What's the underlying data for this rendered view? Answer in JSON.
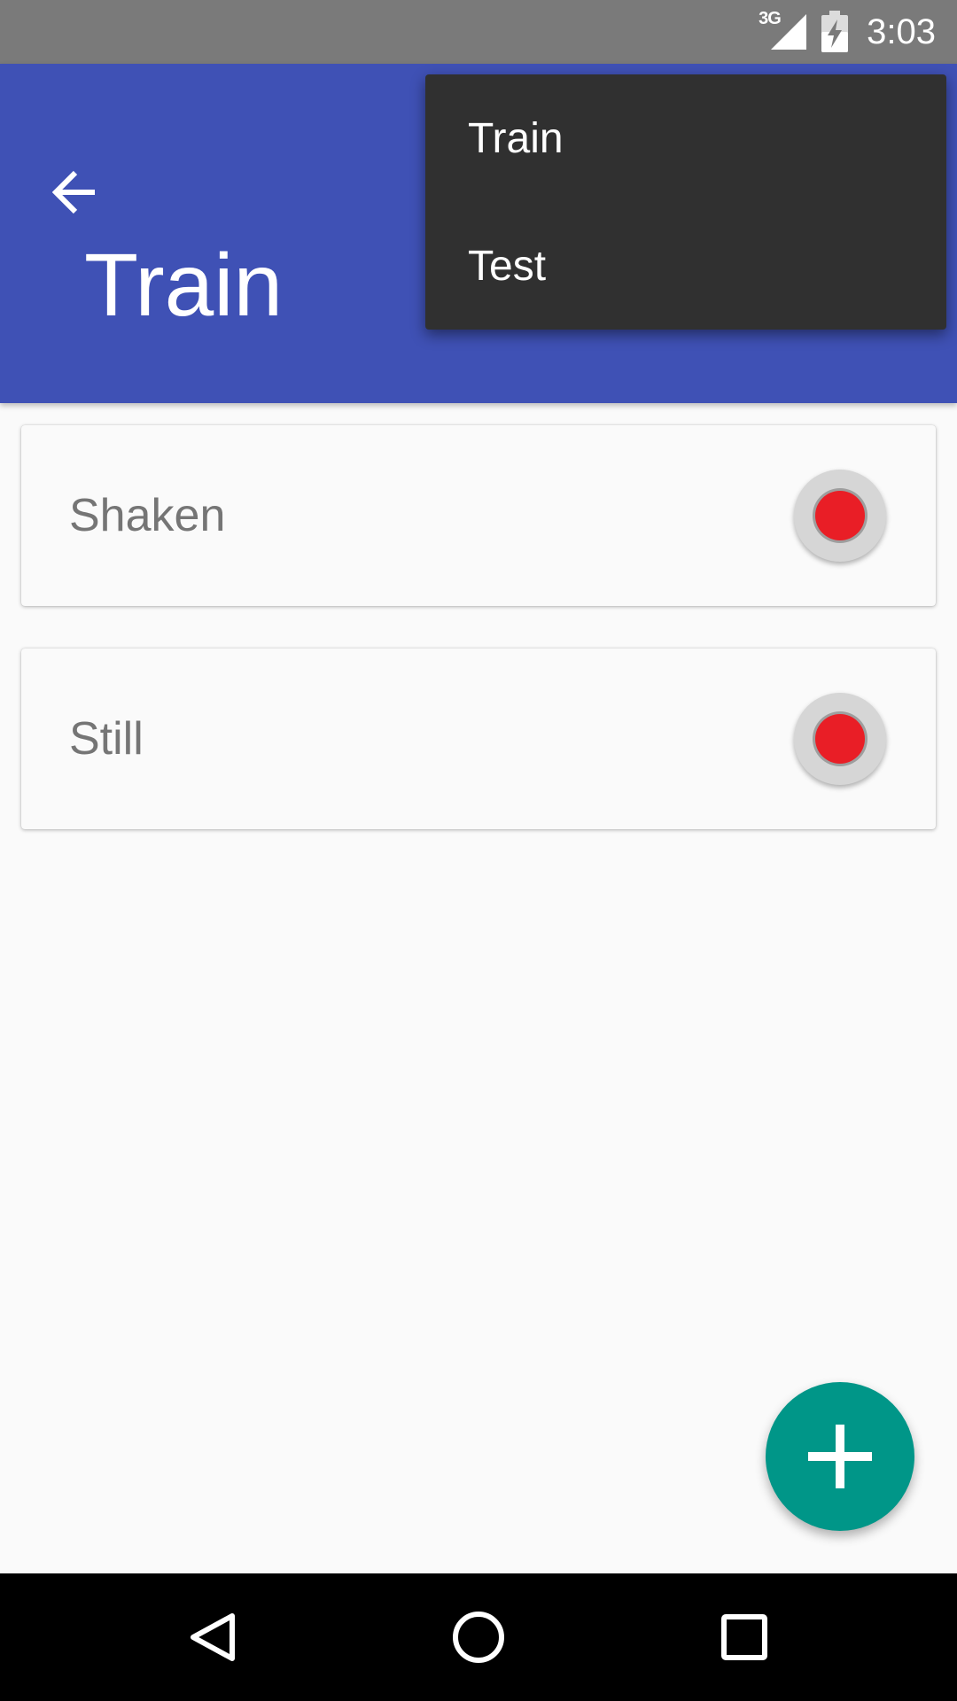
{
  "status_bar": {
    "network_label": "3G",
    "time": "3:03",
    "icons": [
      "signal-icon",
      "battery-charging-icon"
    ]
  },
  "app_bar": {
    "title": "Train",
    "back_icon": "arrow-back-icon",
    "color": "#3f51b5"
  },
  "overflow_menu": {
    "items": [
      {
        "label": "Train"
      },
      {
        "label": "Test"
      }
    ],
    "color": "#303030"
  },
  "list": {
    "items": [
      {
        "label": "Shaken",
        "action_icon": "record-icon"
      },
      {
        "label": "Still",
        "action_icon": "record-icon"
      }
    ],
    "record_color": "#e91e26"
  },
  "fab": {
    "icon": "add-icon",
    "color": "#009688"
  },
  "nav_bar": {
    "buttons": [
      "back-triangle-icon",
      "home-circle-icon",
      "recents-square-icon"
    ]
  }
}
